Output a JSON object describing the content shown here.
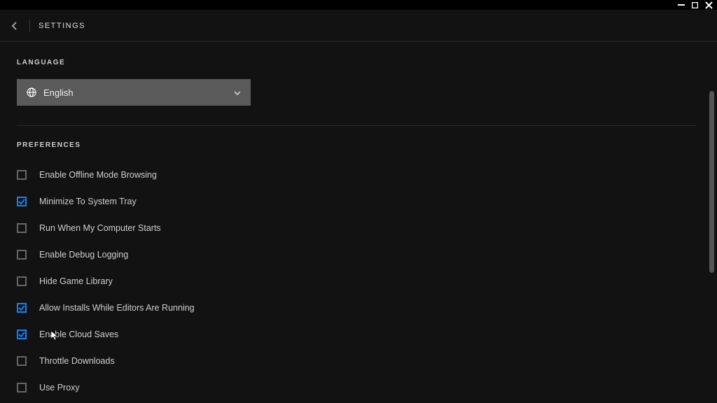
{
  "header": {
    "title": "SETTINGS"
  },
  "language": {
    "section_title": "LANGUAGE",
    "selected": "English"
  },
  "preferences": {
    "section_title": "PREFERENCES",
    "items": [
      {
        "label": "Enable Offline Mode Browsing",
        "checked": false
      },
      {
        "label": "Minimize To System Tray",
        "checked": true
      },
      {
        "label": "Run When My Computer Starts",
        "checked": false
      },
      {
        "label": "Enable Debug Logging",
        "checked": false
      },
      {
        "label": "Hide Game Library",
        "checked": false
      },
      {
        "label": "Allow Installs While Editors Are Running",
        "checked": true
      },
      {
        "label": "Enable Cloud Saves",
        "checked": true
      },
      {
        "label": "Throttle Downloads",
        "checked": false
      },
      {
        "label": "Use Proxy",
        "checked": false
      }
    ]
  }
}
